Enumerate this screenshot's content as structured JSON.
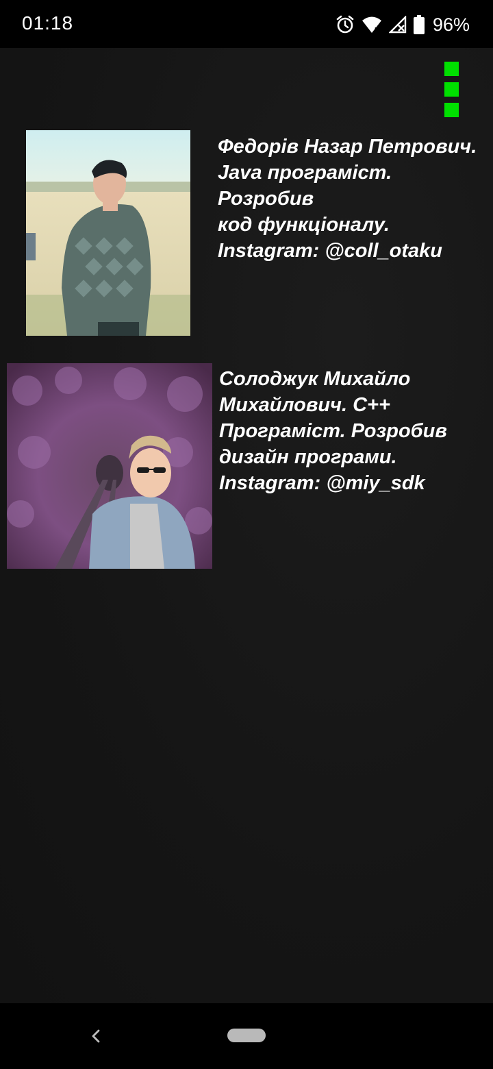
{
  "status_bar": {
    "time": "01:18",
    "battery": "96%",
    "icons": [
      "alarm-icon",
      "wifi-icon",
      "cell-signal-icon",
      "battery-icon"
    ]
  },
  "menu": {
    "icon": "vertical-dots-menu-icon",
    "color": "#00e000"
  },
  "developers": [
    {
      "photo": "portrait-photo-outdoor-field",
      "lines": [
        "Федорів Назар Петрович.",
        "Java програміст. Розробив",
        "код функціоналу.",
        "Instagram: @coll_otaku"
      ]
    },
    {
      "photo": "portrait-photo-tunnel-of-love",
      "lines": [
        "Солоджук Михайло",
        "Михайлович. С++",
        "Програміст. Розробив",
        "дизайн програми.",
        "Instagram: @miy_sdk"
      ]
    }
  ],
  "nav_bar": {
    "back_icon": "back-chevron-icon",
    "home_icon": "home-pill-icon"
  },
  "colors": {
    "background": "#161616",
    "text": "#ffffff",
    "accent": "#00e000"
  }
}
